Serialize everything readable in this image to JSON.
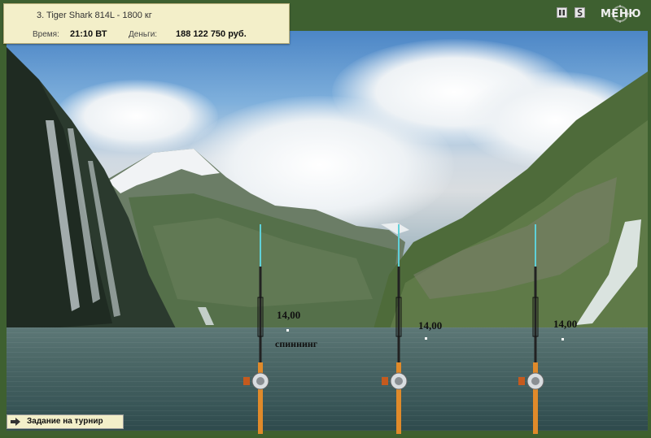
{
  "info": {
    "fish": "3. Tiger Shark 814L - 1800 кг",
    "time_label": "Время:",
    "time_value": "21:10 ВТ",
    "money_label": "Деньги:",
    "money_value": "188 122 750 руб."
  },
  "controls": {
    "pause_icon": "pause-icon",
    "sound_icon": "sound-icon",
    "menu_label": "МЕНЮ"
  },
  "rods": [
    {
      "depth": "14,00",
      "type": "спиннинг"
    },
    {
      "depth": "14,00"
    },
    {
      "depth": "14,00"
    }
  ],
  "task": {
    "label": "Задание на турнир"
  },
  "colors": {
    "frame": "#3e6030",
    "panel": "#f3efc9",
    "rod_tip": "#5fd0d8",
    "rod_blank": "#e08a2a"
  }
}
